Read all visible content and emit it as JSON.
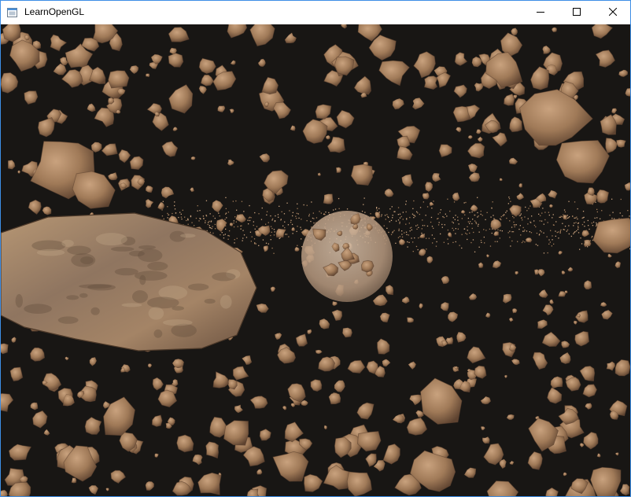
{
  "window": {
    "title": "LearnOpenGL",
    "icon": "app-window-icon",
    "controls": {
      "minimize_icon": "minimize-icon",
      "maximize_icon": "maximize-icon",
      "close_icon": "close-icon"
    }
  },
  "scene": {
    "clear_color": "#181614",
    "rock_color": "#a07a58",
    "rock_light": "#c9a27e",
    "rock_dark": "#5e4330",
    "planet_color": "#b89a80"
  }
}
